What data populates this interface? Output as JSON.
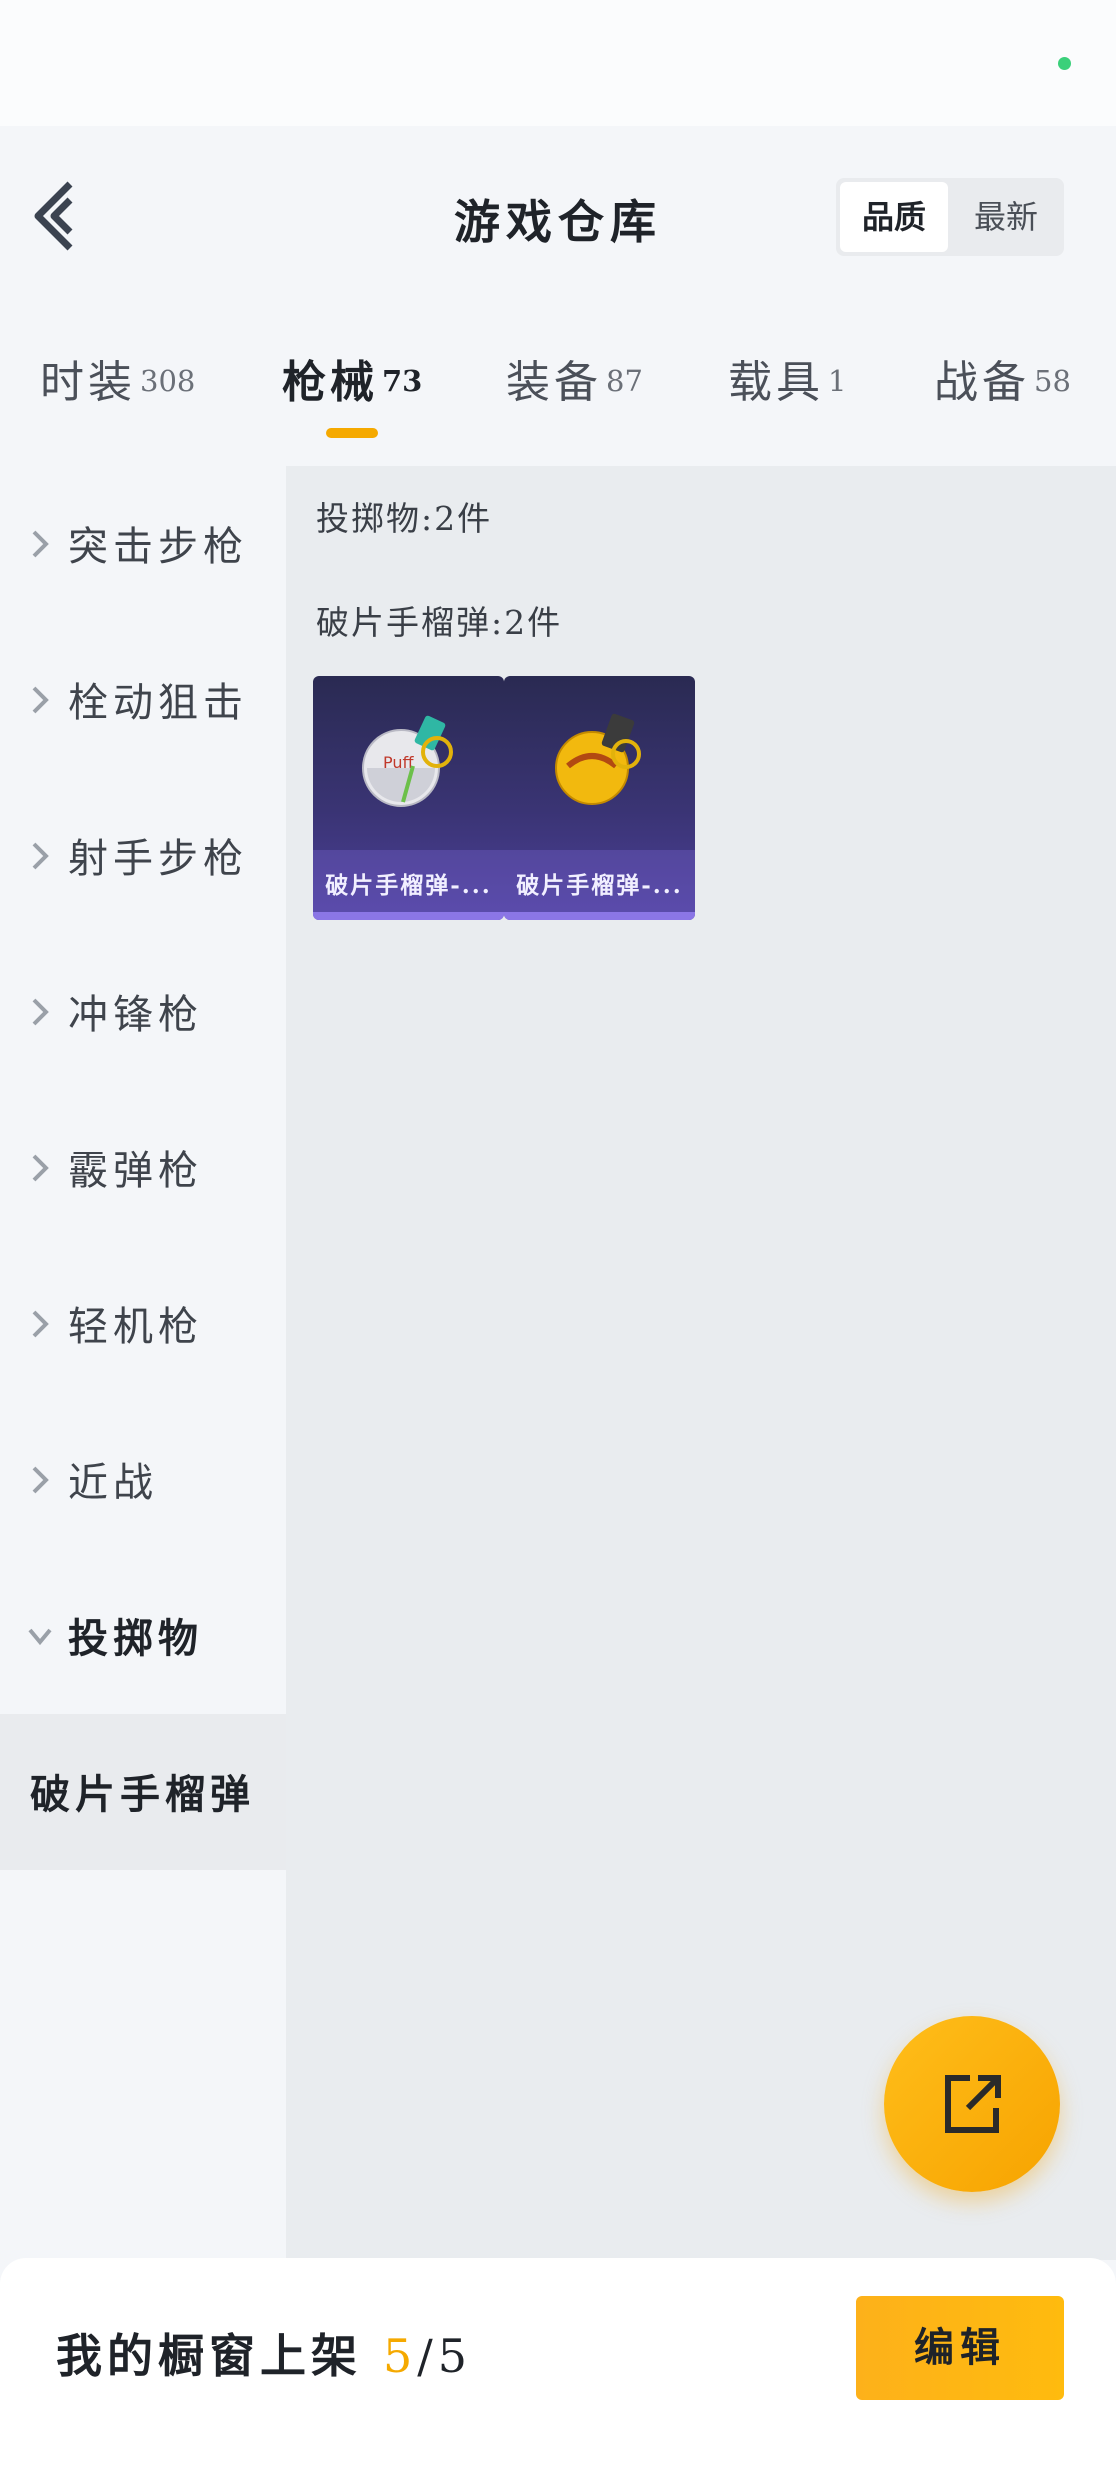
{
  "header": {
    "title": "游戏仓库",
    "sort_options": [
      "品质",
      "最新"
    ]
  },
  "tabs": [
    {
      "label": "时装",
      "count": "308"
    },
    {
      "label": "枪械",
      "count": "73"
    },
    {
      "label": "装备",
      "count": "87"
    },
    {
      "label": "载具",
      "count": "1"
    },
    {
      "label": "战备",
      "count": "58"
    }
  ],
  "sidebar": {
    "items": [
      {
        "label": "突击步枪",
        "icon": "chevron-right-icon"
      },
      {
        "label": "栓动狙击",
        "icon": "chevron-right-icon"
      },
      {
        "label": "射手步枪",
        "icon": "chevron-right-icon"
      },
      {
        "label": "冲锋枪",
        "icon": "chevron-right-icon"
      },
      {
        "label": "霰弹枪",
        "icon": "chevron-right-icon"
      },
      {
        "label": "轻机枪",
        "icon": "chevron-right-icon"
      },
      {
        "label": "近战",
        "icon": "chevron-right-icon"
      },
      {
        "label": "投掷物",
        "icon": "chevron-down-icon"
      }
    ],
    "sub_item": "破片手榴弹"
  },
  "content": {
    "category_heading": "投掷物:2件",
    "group_heading": "破片手榴弹:2件",
    "cards": [
      {
        "label": "破片手榴弹-...",
        "icon": "white-grenade-icon"
      },
      {
        "label": "破片手榴弹-...",
        "icon": "yellow-grenade-icon"
      }
    ]
  },
  "bottom": {
    "shelf_label": "我的橱窗上架",
    "shelf_count": "5",
    "shelf_total": "/5",
    "edit_label": "编辑"
  },
  "colors": {
    "accent": "#f5a900",
    "card_bg": "#3a3474",
    "status_dot": "#3bd07a"
  }
}
